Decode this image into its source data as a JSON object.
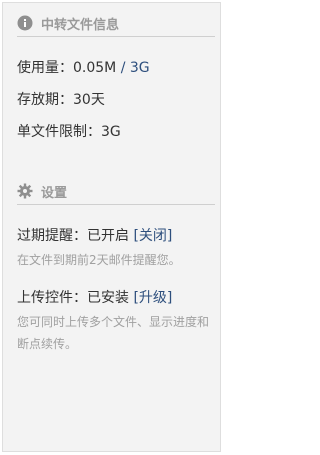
{
  "transfer_info": {
    "title": "中转文件信息",
    "usage_label": "使用量：",
    "usage_used": "0.05M",
    "usage_sep": " / ",
    "usage_total": "3G",
    "storage_label": "存放期：",
    "storage_value": "30天",
    "file_limit_label": "单文件限制：",
    "file_limit_value": "3G"
  },
  "settings": {
    "title": "设置",
    "expiry_label": "过期提醒：",
    "expiry_status": "已开启",
    "expiry_action": "[关闭]",
    "expiry_desc": "在文件到期前2天邮件提醒您。",
    "upload_label": "上传控件：",
    "upload_status": "已安装",
    "upload_action": "[升级]",
    "upload_desc": "您可同时上传多个文件、显示进度和断点续传。"
  },
  "icons": {
    "info": "info-icon",
    "settings": "gear-icon"
  },
  "colors": {
    "panel_bg": "#f3f3f3",
    "header_text": "#9a9a9a",
    "body_text": "#333333",
    "link": "#2e4f7d",
    "desc_text": "#a0a0a0"
  }
}
